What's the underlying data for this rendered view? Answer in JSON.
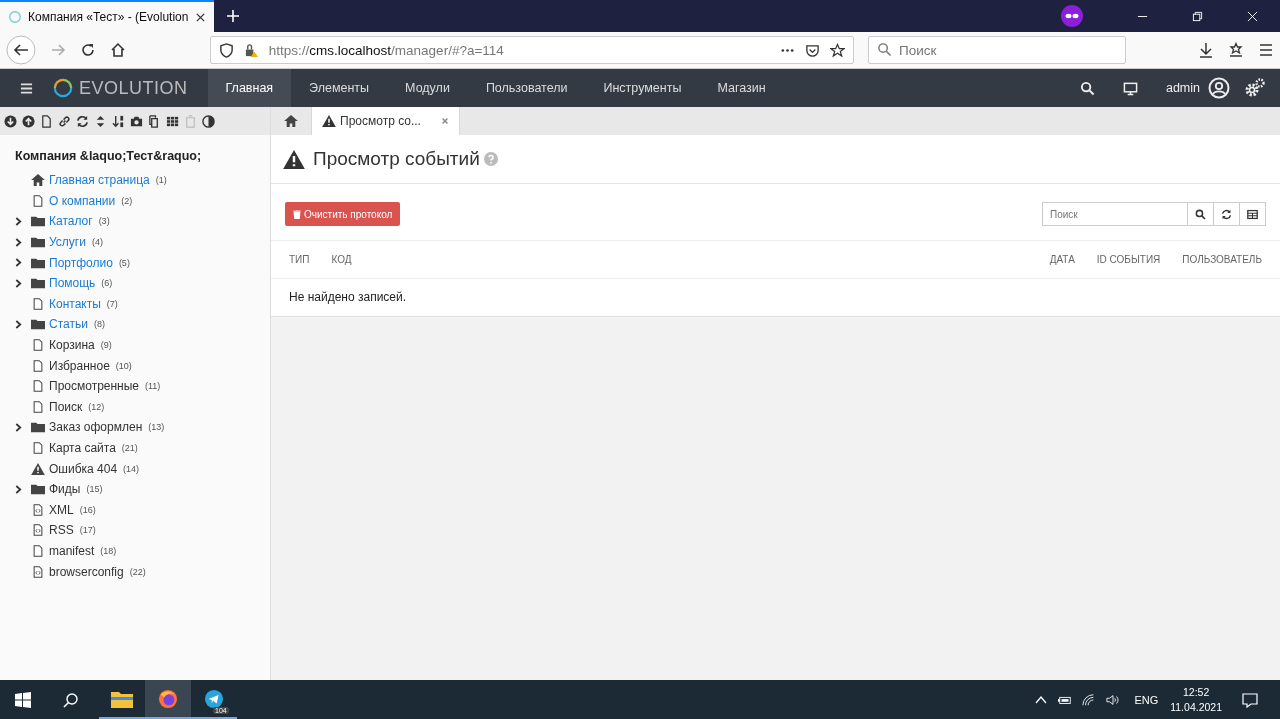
{
  "browser": {
    "tab_title": "Компания «Тест» - (Evolution",
    "url_scheme": "https://",
    "url_host": "cms.localhost",
    "url_path": "/manager/#?a=114",
    "search_placeholder": "Поиск"
  },
  "app": {
    "logo": "EVOLUTION",
    "nav": [
      {
        "label": "Главная",
        "selected": true
      },
      {
        "label": "Элементы",
        "selected": false
      },
      {
        "label": "Модули",
        "selected": false
      },
      {
        "label": "Пользователи",
        "selected": false
      },
      {
        "label": "Инструменты",
        "selected": false
      },
      {
        "label": "Магазин",
        "selected": false
      }
    ],
    "user": "admin"
  },
  "tree_toolbar": [
    {
      "kind": "down",
      "disabled": false
    },
    {
      "kind": "up",
      "disabled": false
    },
    {
      "kind": "file",
      "disabled": false
    },
    {
      "kind": "link",
      "disabled": false
    },
    {
      "kind": "refresh",
      "disabled": false
    },
    {
      "kind": "updown",
      "disabled": false
    },
    {
      "kind": "sort",
      "disabled": false
    },
    {
      "kind": "camera",
      "disabled": false
    },
    {
      "kind": "copy",
      "disabled": false
    },
    {
      "kind": "grid",
      "disabled": false
    },
    {
      "kind": "trash",
      "disabled": true
    },
    {
      "kind": "contrast",
      "disabled": false
    }
  ],
  "tree": {
    "root": "Компания &laquo;Тест&raquo;",
    "items": [
      {
        "kind": "home",
        "label": "Главная страница",
        "id": "(1)",
        "published": true,
        "collapsed": false
      },
      {
        "kind": "page",
        "label": "О компании",
        "id": "(2)",
        "published": true,
        "collapsed": false
      },
      {
        "kind": "folder",
        "label": "Каталог",
        "id": "(3)",
        "published": true,
        "collapsed": true
      },
      {
        "kind": "folder",
        "label": "Услуги",
        "id": "(4)",
        "published": true,
        "collapsed": true
      },
      {
        "kind": "folder",
        "label": "Портфолио",
        "id": "(5)",
        "published": true,
        "collapsed": true
      },
      {
        "kind": "folder",
        "label": "Помощь",
        "id": "(6)",
        "published": true,
        "collapsed": true
      },
      {
        "kind": "page",
        "label": "Контакты",
        "id": "(7)",
        "published": true,
        "collapsed": false
      },
      {
        "kind": "folder",
        "label": "Статьи",
        "id": "(8)",
        "published": true,
        "collapsed": true
      },
      {
        "kind": "page",
        "label": "Корзина",
        "id": "(9)",
        "published": false,
        "collapsed": false
      },
      {
        "kind": "page",
        "label": "Избранное",
        "id": "(10)",
        "published": false,
        "collapsed": false
      },
      {
        "kind": "page",
        "label": "Просмотренные",
        "id": "(11)",
        "published": false,
        "collapsed": false
      },
      {
        "kind": "page",
        "label": "Поиск",
        "id": "(12)",
        "published": false,
        "collapsed": false
      },
      {
        "kind": "folder",
        "label": "Заказ оформлен",
        "id": "(13)",
        "published": false,
        "collapsed": true
      },
      {
        "kind": "page",
        "label": "Карта сайта",
        "id": "(21)",
        "published": false,
        "collapsed": false
      },
      {
        "kind": "warning",
        "label": "Ошибка 404",
        "id": "(14)",
        "published": false,
        "collapsed": false
      },
      {
        "kind": "folder",
        "label": "Фиды",
        "id": "(15)",
        "published": false,
        "collapsed": true
      },
      {
        "kind": "code",
        "label": "XML",
        "id": "(16)",
        "published": false,
        "collapsed": false
      },
      {
        "kind": "code",
        "label": "RSS",
        "id": "(17)",
        "published": false,
        "collapsed": false
      },
      {
        "kind": "page",
        "label": "manifest",
        "id": "(18)",
        "published": false,
        "collapsed": false
      },
      {
        "kind": "code",
        "label": "browserconfig",
        "id": "(22)",
        "published": false,
        "collapsed": false
      }
    ]
  },
  "tabs": [
    {
      "kind": "home",
      "selected": false
    },
    {
      "kind": "page",
      "label": "Просмотр со...",
      "selected": true
    }
  ],
  "page": {
    "title": "Просмотр событий",
    "clear_button": "Очистить протокол",
    "search_placeholder": "Поиск",
    "columns": [
      "ТИП",
      "КОД",
      "ДАТА",
      "ID СОБЫТИЯ",
      "ПОЛЬЗОВАТЕЛЬ"
    ],
    "empty_message": "Не найдено записей."
  },
  "taskbar": {
    "apps": [
      {
        "kind": "explorer",
        "selected": false
      },
      {
        "kind": "firefox",
        "selected": true
      },
      {
        "kind": "telegram",
        "selected": false,
        "badge": "104"
      }
    ],
    "language": "ENG",
    "time": "12:52",
    "date": "11.04.2021"
  }
}
